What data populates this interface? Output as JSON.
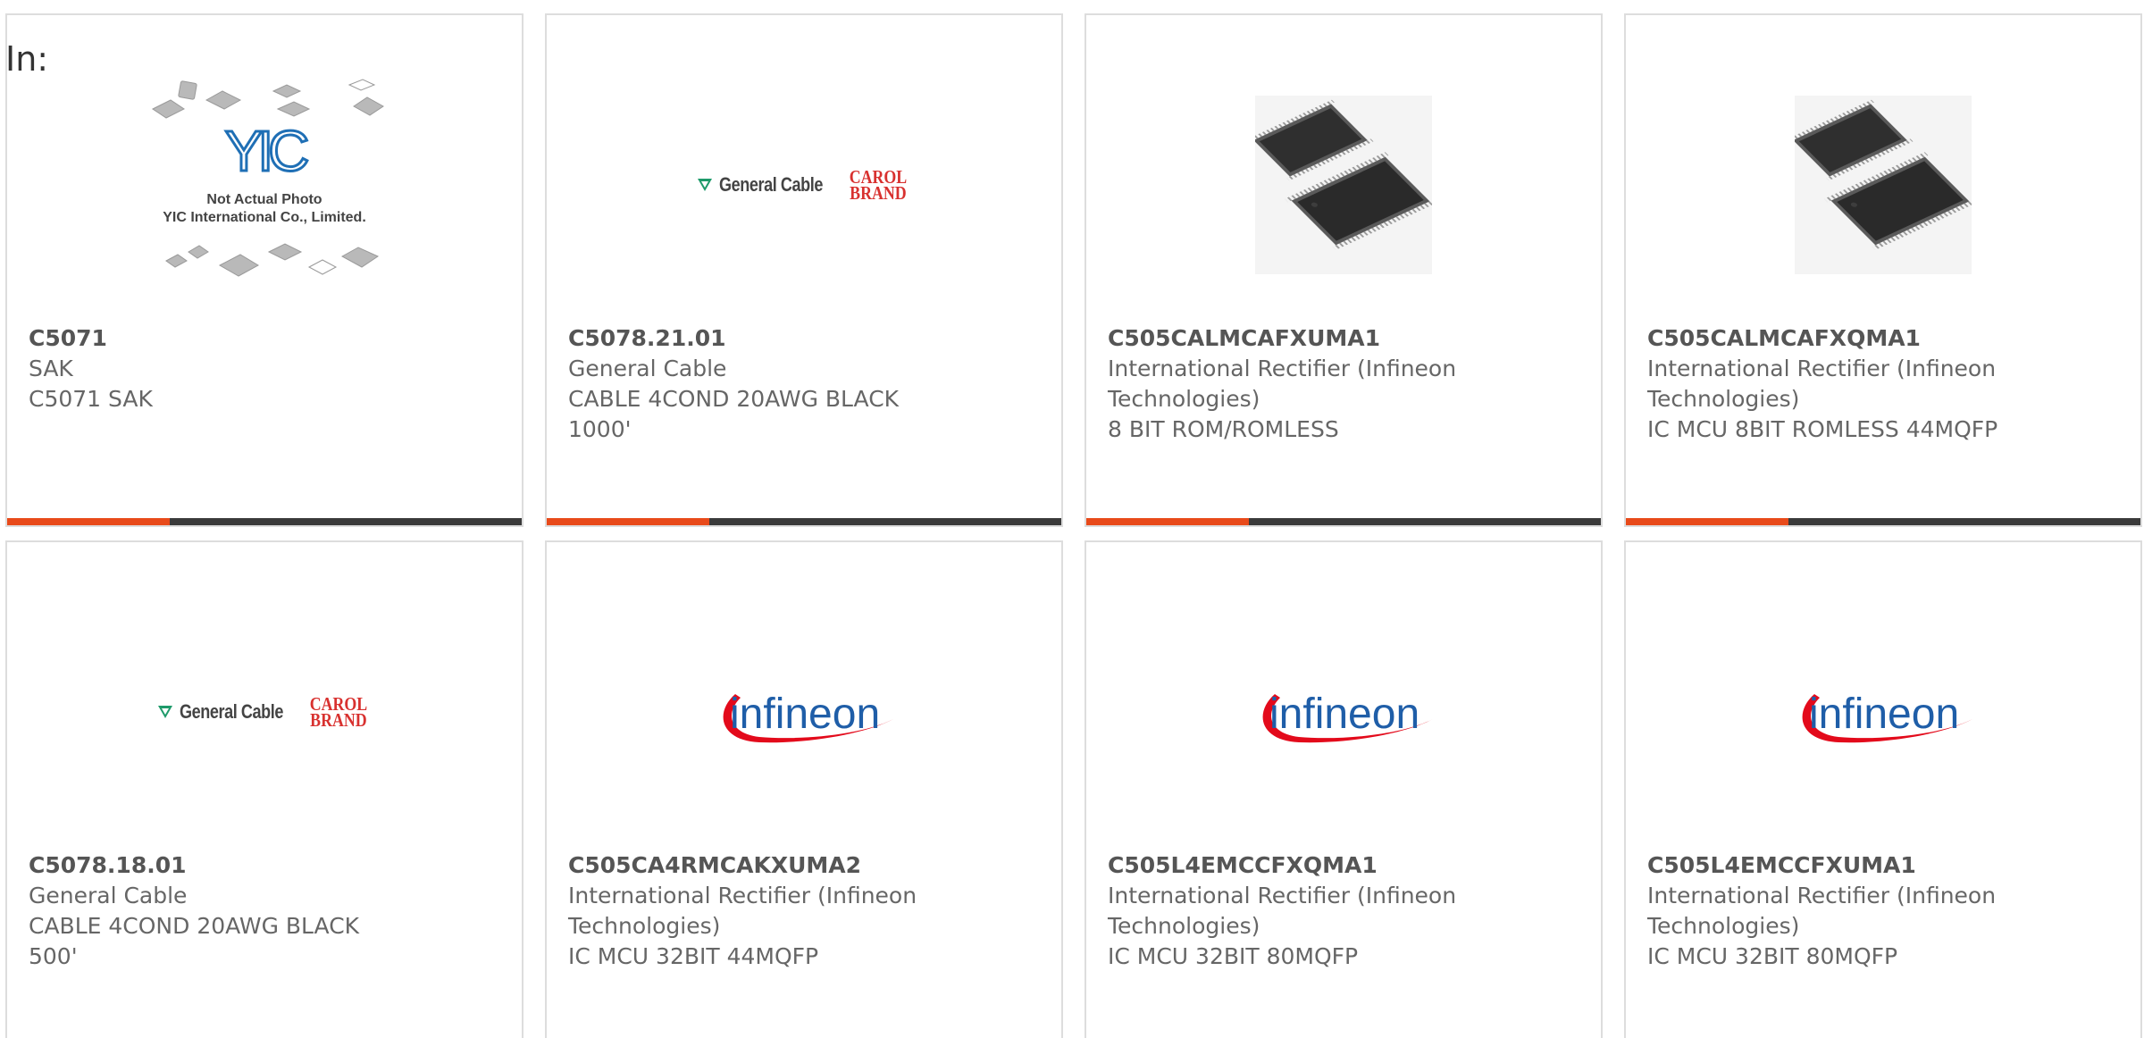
{
  "filter": {
    "label": "In:"
  },
  "products": [
    {
      "part_number": "C5071",
      "manufacturer": "SAK",
      "description": "C5071 SAK",
      "image": "yic-placeholder"
    },
    {
      "part_number": "C5078.21.01",
      "manufacturer": "General Cable",
      "description": "CABLE 4COND 20AWG BLACK 1000'",
      "image": "general-cable-logo"
    },
    {
      "part_number": "C505CALMCAFXUMA1",
      "manufacturer": "International Rectifier (Infineon Technologies)",
      "description": "8 BIT ROM/ROMLESS",
      "image": "qfp-chip-photo"
    },
    {
      "part_number": "C505CALMCAFXQMA1",
      "manufacturer": "International Rectifier (Infineon Technologies)",
      "description": "IC MCU 8BIT ROMLESS 44MQFP",
      "image": "qfp-chip-photo"
    },
    {
      "part_number": "C5078.18.01",
      "manufacturer": "General Cable",
      "description": "CABLE 4COND 20AWG BLACK 500'",
      "image": "general-cable-logo"
    },
    {
      "part_number": "C505CA4RMCAKXUMA2",
      "manufacturer": "International Rectifier (Infineon Technologies)",
      "description": "IC MCU 32BIT 44MQFP",
      "image": "infineon-logo"
    },
    {
      "part_number": "C505L4EMCCFXQMA1",
      "manufacturer": "International Rectifier (Infineon Technologies)",
      "description": "IC MCU 32BIT 80MQFP",
      "image": "infineon-logo"
    },
    {
      "part_number": "C505L4EMCCFXUMA1",
      "manufacturer": "International Rectifier (Infineon Technologies)",
      "description": "IC MCU 32BIT 80MQFP",
      "image": "infineon-logo"
    }
  ],
  "logos": {
    "yic": {
      "mark": "YIC",
      "line1": "Not Actual Photo",
      "line2": "YIC International Co., Limited."
    },
    "general_cable": {
      "name": "General Cable",
      "brand_line1": "CAROL",
      "brand_line2": "BRAND"
    },
    "infineon": {
      "name": "infineon"
    }
  },
  "colors": {
    "accent": "#e84a1a",
    "bar": "#3a3a3a",
    "border": "#dddddd",
    "text": "#666666",
    "infineon_blue": "#1f5ea8",
    "infineon_red": "#e30a1b",
    "carol_red": "#d8312f",
    "gc_green": "#1e9a6a"
  }
}
